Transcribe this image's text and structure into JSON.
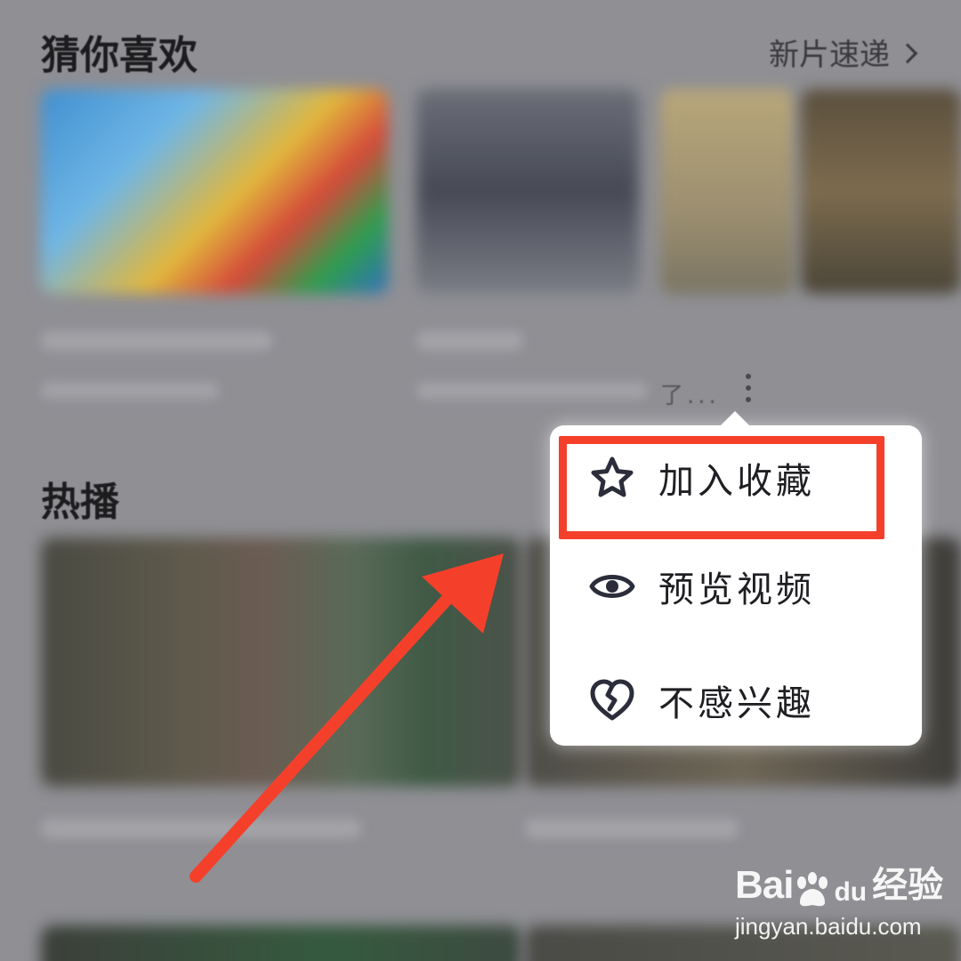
{
  "sections": {
    "guess": {
      "title": "猜你喜欢",
      "more": "新片速递"
    },
    "hot": {
      "title": "热播"
    }
  },
  "card": {
    "truncated_text": "了..."
  },
  "menu": {
    "items": [
      {
        "icon": "star-icon",
        "label": "加入收藏"
      },
      {
        "icon": "eye-icon",
        "label": "预览视频"
      },
      {
        "icon": "broken-heart-icon",
        "label": "不感兴趣"
      }
    ]
  },
  "annotation": {
    "highlight_color": "#f4402b",
    "arrow_color": "#f4402b"
  },
  "watermark": {
    "brand": "Bai",
    "brand_du": "du",
    "brand_cn": "经验",
    "url": "jingyan.baidu.com"
  }
}
